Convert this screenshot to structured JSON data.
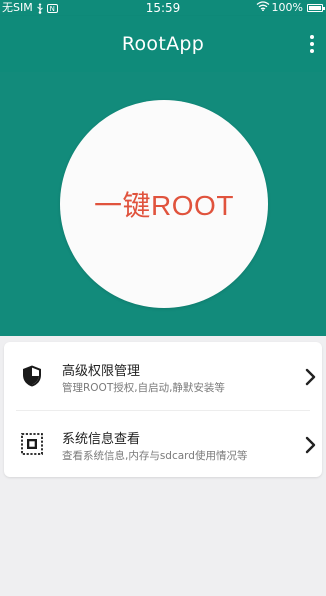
{
  "status_bar": {
    "carrier": "无SIM",
    "notification_badge": "N",
    "time": "15:59",
    "battery": "100%",
    "icons": [
      "usb-icon",
      "notification-icon",
      "wifi-icon",
      "battery-icon"
    ]
  },
  "app_bar": {
    "title": "RootApp",
    "menu_icon": "more-vert-icon"
  },
  "hero": {
    "button_label": "一键ROOT"
  },
  "menu": {
    "items": [
      {
        "title": "高级权限管理",
        "subtitle": "管理ROOT授权,自启动,静默安装等",
        "icon": "shield-icon"
      },
      {
        "title": "系统信息查看",
        "subtitle": "查看系统信息,内存与sdcard使用情况等",
        "icon": "system-info-icon"
      }
    ]
  },
  "colors": {
    "primary": "#0f8b7a",
    "accent_text": "#e0533d",
    "background": "#efeff1",
    "card": "#ffffff"
  }
}
